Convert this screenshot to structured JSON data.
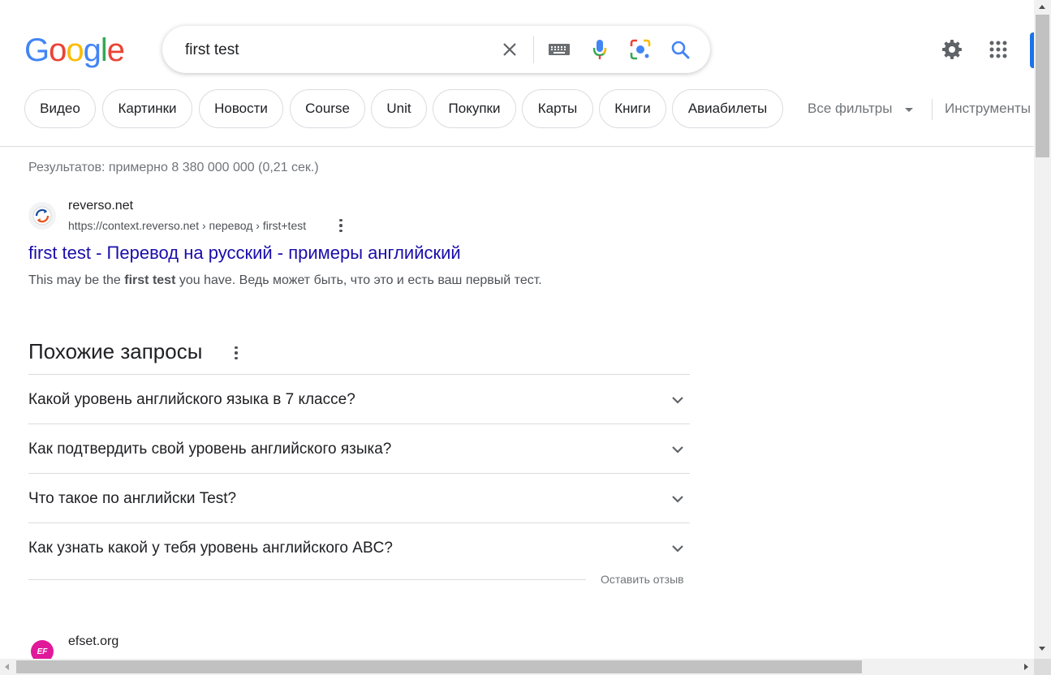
{
  "logo": {
    "letters": [
      "G",
      "o",
      "o",
      "g",
      "l",
      "e"
    ],
    "colors": [
      "#4285f4",
      "#ea4335",
      "#fbbc05",
      "#4285f4",
      "#34a853",
      "#ea4335"
    ]
  },
  "search": {
    "query": "first test"
  },
  "header_icons": {
    "clear": "close-icon",
    "keyboard": "keyboard-icon",
    "voice": "mic-icon",
    "lens": "camera-lens-icon",
    "search": "search-icon",
    "settings": "gear-icon",
    "apps": "apps-grid-icon"
  },
  "chips": [
    {
      "label": "Видео"
    },
    {
      "label": "Картинки"
    },
    {
      "label": "Новости"
    },
    {
      "label": "Course"
    },
    {
      "label": "Unit"
    },
    {
      "label": "Покупки"
    },
    {
      "label": "Карты"
    },
    {
      "label": "Книги"
    },
    {
      "label": "Авиабилеты"
    }
  ],
  "tools": {
    "all_filters": "Все фильтры",
    "instruments": "Инструменты"
  },
  "stats": "Результатов: примерно 8 380 000 000 (0,21 сек.)",
  "result1": {
    "site_name": "reverso.net",
    "url": "https://context.reverso.net › перевод › first+test",
    "title": "first test - Перевод на русский - примеры английский",
    "snippet_before": "This may be the ",
    "snippet_bold": "first test",
    "snippet_after": " you have. Ведь может быть, что это и есть ваш первый тест."
  },
  "paa": {
    "title": "Похожие запросы",
    "questions": [
      "Какой уровень английского языка в 7 классе?",
      "Как подтвердить свой уровень английского языка?",
      "Что такое по английски Test?",
      "Как узнать какой у тебя уровень английского ABC?"
    ],
    "feedback": "Оставить отзыв"
  },
  "result2": {
    "site_name": "efset.org",
    "favicon_text": "EF"
  },
  "colors": {
    "link": "#1a0dab",
    "accent": "#1a73e8",
    "ef_brand": "#e0199a"
  }
}
